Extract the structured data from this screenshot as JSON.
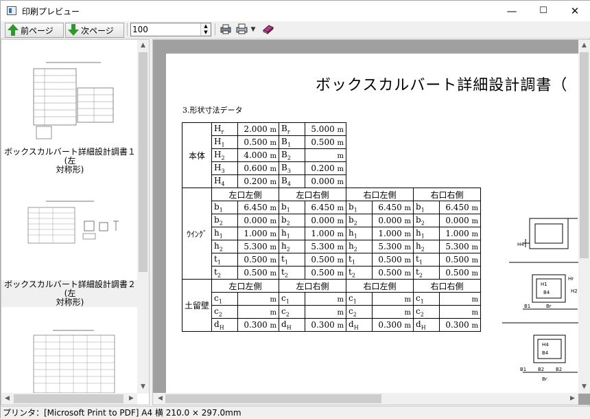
{
  "window": {
    "title": "印刷プレビュー",
    "minimize": "—",
    "maximize": "☐",
    "close": "✕"
  },
  "toolbar": {
    "prev_label": "前ページ",
    "next_label": "次ページ",
    "zoom_value": "100"
  },
  "thumbnails": [
    {
      "caption_line1": "ボックスカルバート詳細設計調書１(左",
      "caption_line2": "対称形)",
      "selected": false
    },
    {
      "caption_line1": "ボックスカルバート詳細設計調書２(左",
      "caption_line2": "対称形)",
      "selected": true
    }
  ],
  "preview": {
    "title": "ボックスカルバート詳細設計調書（",
    "section": "3.形状寸法データ",
    "body_label": "本体",
    "wing_label": "ｳｲﾝｸﾞ",
    "earth_label": "土留壁",
    "body_rows": [
      {
        "sym1": "Hr",
        "val1": "2.000",
        "sym2": "Br",
        "val2": "5.000"
      },
      {
        "sym1": "H1",
        "val1": "0.500",
        "sym2": "B1",
        "val2": "0.500"
      },
      {
        "sym1": "H2",
        "val1": "4.000",
        "sym2": "B2",
        "val2": ""
      },
      {
        "sym1": "H3",
        "val1": "0.600",
        "sym2": "B3",
        "val2": "0.200"
      },
      {
        "sym1": "H4",
        "val1": "0.200",
        "sym2": "B4",
        "val2": "0.000"
      }
    ],
    "unit": "m",
    "wing_headers": [
      "左口左側",
      "左口右側",
      "右口左側",
      "右口右側"
    ],
    "wing_rows": [
      {
        "sym": "b1",
        "vals": [
          "6.450",
          "6.450",
          "6.450",
          "6.450"
        ]
      },
      {
        "sym": "b2",
        "vals": [
          "0.000",
          "0.000",
          "0.000",
          "0.000"
        ]
      },
      {
        "sym": "h1",
        "vals": [
          "1.000",
          "1.000",
          "1.000",
          "1.000"
        ]
      },
      {
        "sym": "h2",
        "vals": [
          "5.300",
          "5.300",
          "5.300",
          "5.300"
        ]
      },
      {
        "sym": "t1",
        "vals": [
          "0.500",
          "0.500",
          "0.500",
          "0.500"
        ]
      },
      {
        "sym": "t2",
        "vals": [
          "0.500",
          "0.500",
          "0.500",
          "0.500"
        ]
      }
    ],
    "earth_headers": [
      "左口左側",
      "左口右側",
      "右口左側",
      "右口右側"
    ],
    "earth_rows": [
      {
        "sym": "c1",
        "vals": [
          "",
          "",
          "",
          ""
        ]
      },
      {
        "sym": "c2",
        "vals": [
          "",
          "",
          "",
          ""
        ]
      },
      {
        "sym": "dH",
        "vals": [
          "0.300",
          "0.300",
          "0.300",
          "0.300"
        ]
      }
    ]
  },
  "status": {
    "text": "プリンタ：[Microsoft Print to PDF] A4 横  210.0 × 297.0mm"
  }
}
